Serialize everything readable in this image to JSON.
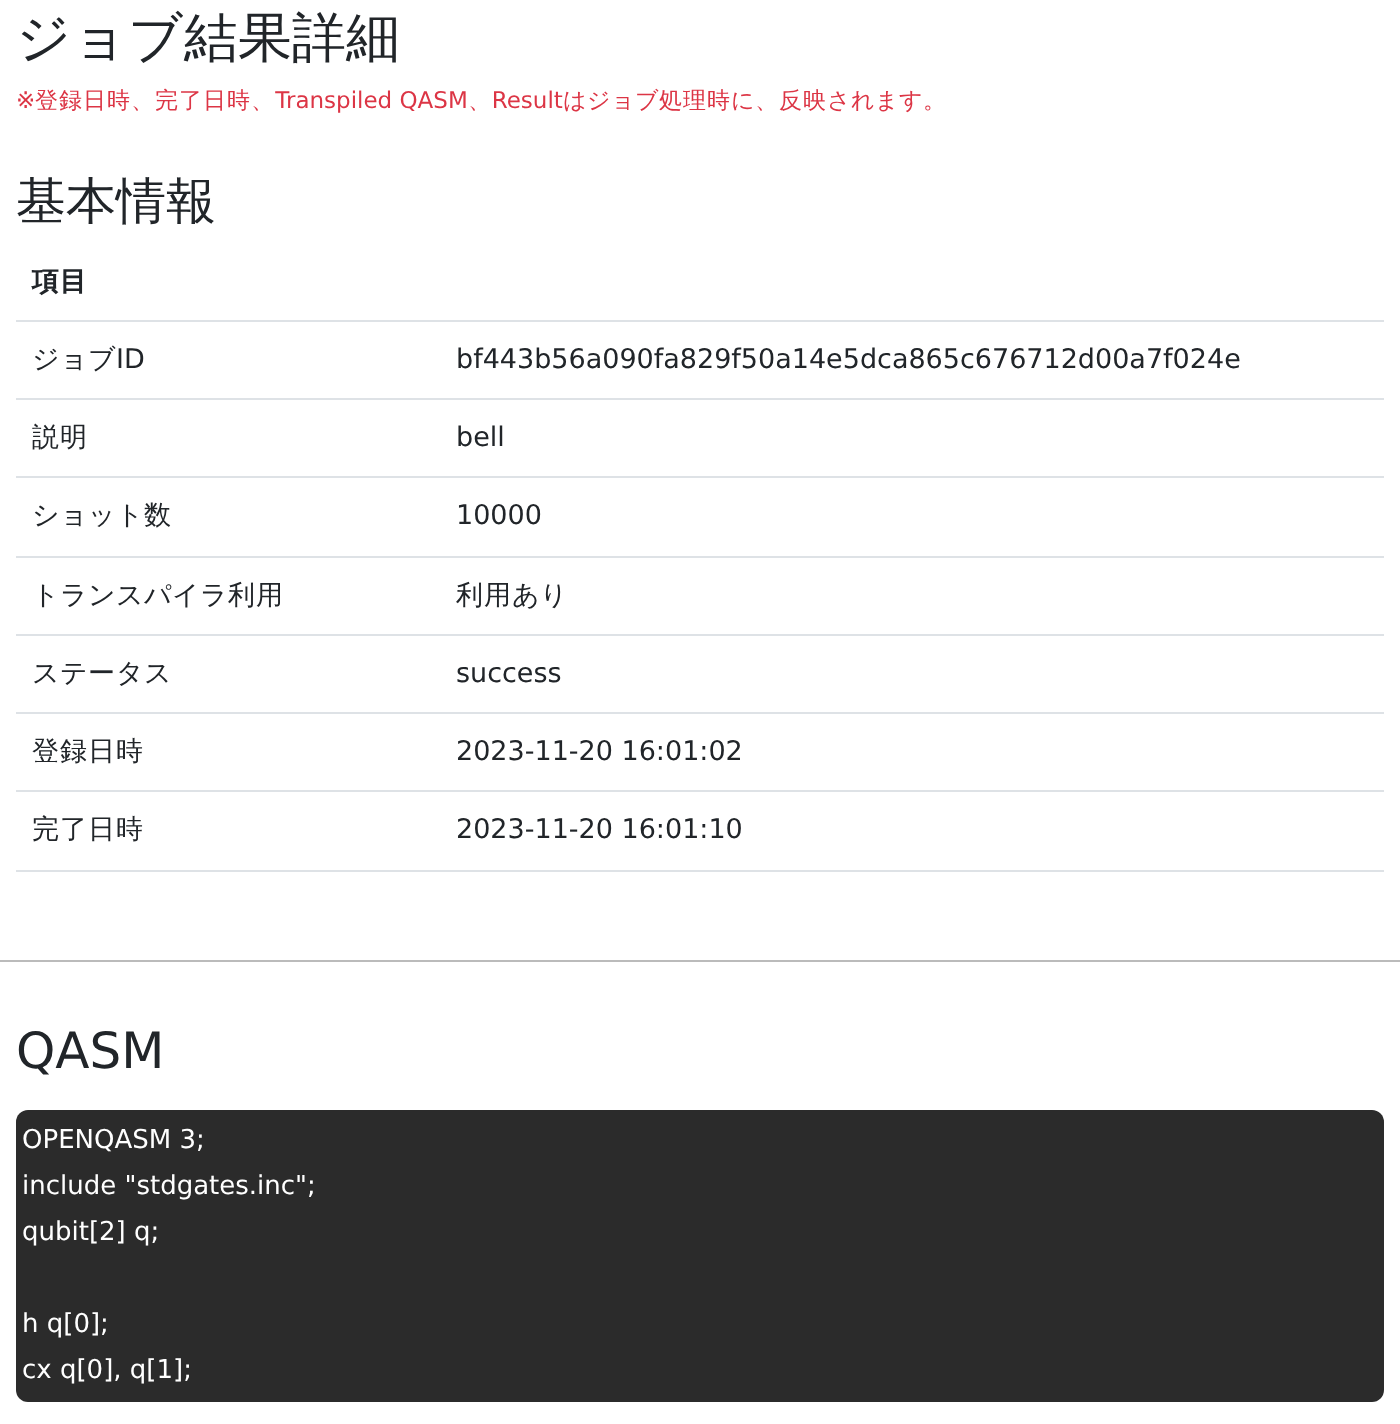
{
  "page_title": "ジョブ結果詳細",
  "note": "※登録日時、完了日時、Transpiled QASM、Resultはジョブ処理時に、反映されます。",
  "basic_info": {
    "heading": "基本情報",
    "columns": [
      "項目"
    ],
    "rows": [
      {
        "label": "ジョブID",
        "value": "bf443b56a090fa829f50a14e5dca865c676712d00a7f024e"
      },
      {
        "label": "説明",
        "value": "bell"
      },
      {
        "label": "ショット数",
        "value": "10000"
      },
      {
        "label": "トランスパイラ利用",
        "value": "利用あり"
      },
      {
        "label": "ステータス",
        "value": "success"
      },
      {
        "label": "登録日時",
        "value": "2023-11-20 16:01:02"
      },
      {
        "label": "完了日時",
        "value": "2023-11-20 16:01:10"
      }
    ]
  },
  "qasm": {
    "heading": "QASM",
    "code": "OPENQASM 3;\ninclude \"stdgates.inc\";\nqubit[2] q;\n\nh q[0];\ncx q[0], q[1];"
  }
}
